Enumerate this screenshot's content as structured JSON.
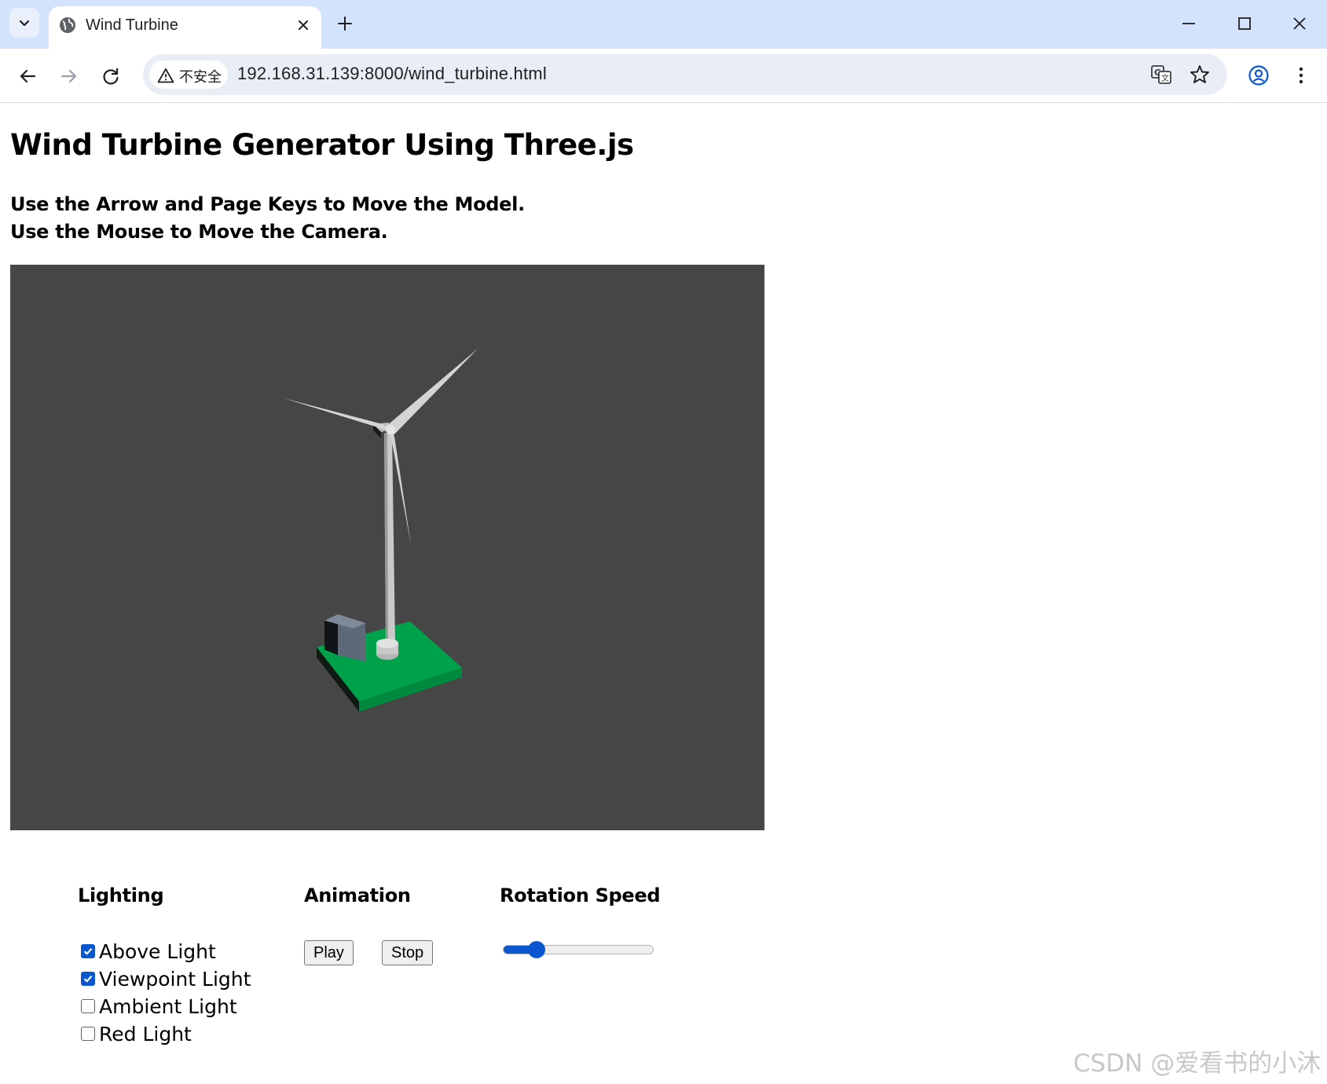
{
  "browser": {
    "tab_title": "Wind Turbine",
    "security_label": "不安全",
    "url": "192.168.31.139:8000/wind_turbine.html"
  },
  "page": {
    "title": "Wind Turbine Generator Using Three.js",
    "instructions": [
      "Use the Arrow and Page Keys to Move the Model.",
      "Use the Mouse to Move the Camera."
    ]
  },
  "scene": {
    "background_color": "#464646",
    "base_color": "#00a14b",
    "box_color": "#5e6978",
    "tower_color": "#c9c9c9"
  },
  "controls": {
    "lighting": {
      "title": "Lighting",
      "options": [
        {
          "label": "Above Light",
          "checked": true
        },
        {
          "label": "Viewpoint Light",
          "checked": true
        },
        {
          "label": "Ambient Light",
          "checked": false
        },
        {
          "label": "Red Light",
          "checked": false
        }
      ]
    },
    "animation": {
      "title": "Animation",
      "play_label": "Play",
      "stop_label": "Stop"
    },
    "rotation_speed": {
      "title": "Rotation Speed",
      "value_fraction": 0.19
    }
  },
  "watermark": "CSDN @爱看书的小沐"
}
